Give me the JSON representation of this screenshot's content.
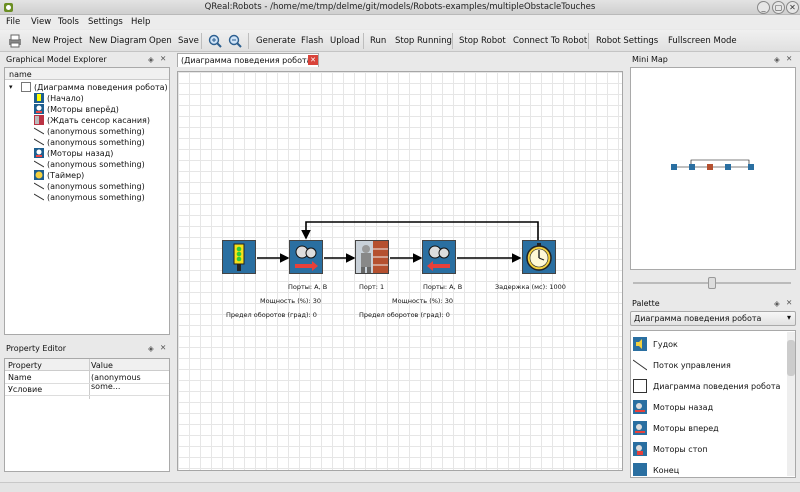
{
  "window": {
    "title": "QReal:Robots - /home/me/tmp/delme/git/models/Robots-examples/multipleObstacleTouches"
  },
  "menu": [
    "File",
    "View",
    "Tools",
    "Settings",
    "Help"
  ],
  "toolbar": {
    "new_project": "New Project",
    "new_diagram": "New Diagram",
    "open": "Open",
    "save": "Save",
    "generate": "Generate",
    "flash": "Flash",
    "upload": "Upload",
    "run": "Run",
    "stop_running": "Stop Running",
    "stop_robot": "Stop Robot",
    "connect": "Connect To Robot",
    "robot_settings": "Robot Settings",
    "fullscreen": "Fullscreen Mode"
  },
  "explorer": {
    "title": "Graphical Model Explorer",
    "column": "name",
    "items": [
      "(Диаграмма поведения робота)",
      "(Начало)",
      "(Моторы вперёд)",
      "(Ждать сенсор касания)",
      "(anonymous something)",
      "(anonymous something)",
      "(Моторы назад)",
      "(anonymous something)",
      "(Таймер)",
      "(anonymous something)",
      "(anonymous something)"
    ]
  },
  "tab": {
    "label": "(Диаграмма поведения робота)"
  },
  "diagram": {
    "label_motors1_ports": "Порты: A, B",
    "label_motors1_power": "Мощность (%): 30",
    "label_motors1_degrees": "Предел оборотов (град): 0",
    "label_sensor_port": "Порт: 1",
    "label_motors2_ports": "Порты: A, B",
    "label_motors2_power": "Мощность (%): 30",
    "label_motors2_degrees": "Предел оборотов (град): 0",
    "label_timer": "Задержка (мс): 1000"
  },
  "property_editor": {
    "title": "Property Editor",
    "col_property": "Property",
    "col_value": "Value",
    "rows": [
      {
        "name": "Name",
        "value": "(anonymous some..."
      },
      {
        "name": "Условие",
        "value": ""
      }
    ]
  },
  "minimap": {
    "title": "Mini Map"
  },
  "palette": {
    "title": "Palette",
    "selected": "Диаграмма поведения робота",
    "items": [
      "Гудок",
      "Поток управления",
      "Диаграмма поведения робота",
      "Моторы назад",
      "Моторы вперед",
      "Моторы стоп",
      "Конец"
    ]
  }
}
